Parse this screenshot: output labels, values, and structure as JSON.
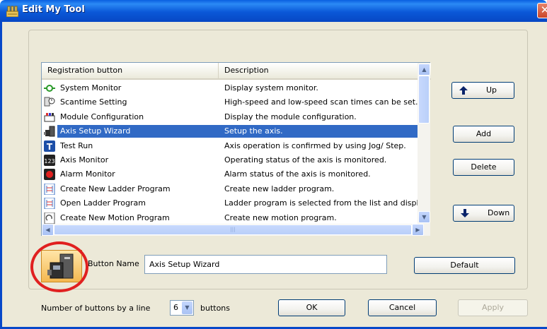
{
  "window": {
    "title": "Edit My Tool",
    "close_glyph": "✕"
  },
  "list": {
    "columns": [
      "Registration button",
      "Description"
    ],
    "rows": [
      {
        "icon": "system-monitor-icon",
        "name": "System Monitor",
        "description": "Display system monitor.",
        "selected": false
      },
      {
        "icon": "scantime-setting-icon",
        "name": "Scantime Setting",
        "description": "High-speed and low-speed scan times can be set.",
        "selected": false
      },
      {
        "icon": "module-configuration-icon",
        "name": "Module Configuration",
        "description": "Display the module configuration.",
        "selected": false
      },
      {
        "icon": "axis-setup-wizard-icon",
        "name": "Axis Setup Wizard",
        "description": "Setup the axis.",
        "selected": true
      },
      {
        "icon": "test-run-icon",
        "name": "Test Run",
        "description": "Axis operation is confirmed by using Jog/ Step.",
        "selected": false
      },
      {
        "icon": "axis-monitor-icon",
        "name": "Axis Monitor",
        "description": "Operating status of the axis is monitored.",
        "selected": false
      },
      {
        "icon": "alarm-monitor-icon",
        "name": "Alarm Monitor",
        "description": "Alarm status of the axis is monitored.",
        "selected": false
      },
      {
        "icon": "ladder-program-icon",
        "name": "Create New Ladder Program",
        "description": "Create new ladder program.",
        "selected": false
      },
      {
        "icon": "ladder-program-icon",
        "name": "Open Ladder Program",
        "description": "Ladder program is selected from the list and displa",
        "selected": false
      },
      {
        "icon": "motion-program-icon",
        "name": "Create New Motion Program",
        "description": "Create new motion program.",
        "selected": false
      }
    ]
  },
  "side_buttons": {
    "up": "Up",
    "add": "Add",
    "delete": "Delete",
    "down": "Down"
  },
  "button_name": {
    "label": "Button Name",
    "value": "Axis Setup Wizard",
    "default_label": "Default"
  },
  "footer": {
    "num_label": "Number of buttons by a line",
    "num_value": "6",
    "buttons_label": "buttons",
    "ok": "OK",
    "cancel": "Cancel",
    "apply": "Apply"
  },
  "colors": {
    "selection": "#316ac5",
    "titlebar": "#0a58d8",
    "highlight_circle": "#e02020"
  }
}
